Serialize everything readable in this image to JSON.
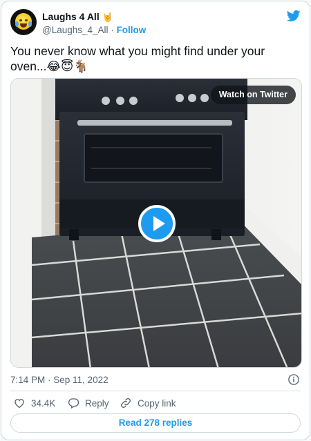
{
  "author": {
    "display_name": "Laughs 4 All",
    "name_emoji": "🤘",
    "handle": "@Laughs_4_All",
    "separator": "·",
    "follow_label": "Follow"
  },
  "tweet": {
    "text": "You never know what you might find under your oven...😂😇🐐",
    "timestamp": "7:14 PM · Sep 11, 2022"
  },
  "media": {
    "watch_label": "Watch on Twitter"
  },
  "actions": {
    "like_count": "34.4K",
    "reply_label": "Reply",
    "copy_label": "Copy link"
  },
  "replies_button": "Read 278 replies",
  "colors": {
    "accent": "#1d9bf0",
    "text_primary": "#0f1419",
    "text_secondary": "#536471",
    "border": "#cfd9de"
  },
  "icons": [
    "twitter-logo-icon",
    "play-icon",
    "info-icon",
    "heart-icon",
    "reply-icon",
    "link-icon"
  ]
}
